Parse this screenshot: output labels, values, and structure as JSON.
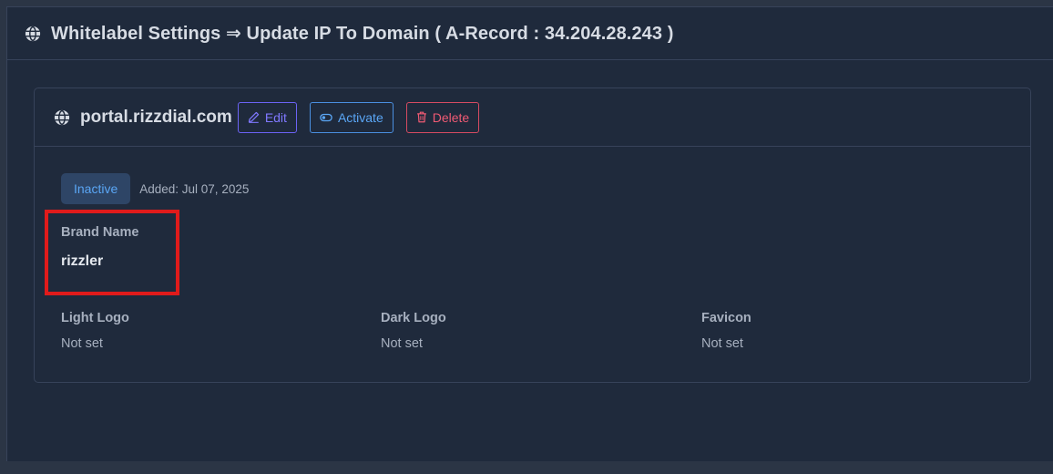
{
  "header": {
    "title": "Whitelabel Settings ⇒ Update IP To Domain ( A-Record : 34.204.28.243 )"
  },
  "card": {
    "domain": "portal.rizzdial.com",
    "buttons": {
      "edit": "Edit",
      "activate": "Activate",
      "delete": "Delete"
    },
    "status": "Inactive",
    "added": "Added: Jul 07, 2025",
    "brand_label": "Brand Name",
    "brand_value": "rizzler",
    "fields": [
      {
        "label": "Light Logo",
        "value": "Not set"
      },
      {
        "label": "Dark Logo",
        "value": "Not set"
      },
      {
        "label": "Favicon",
        "value": "Not set"
      }
    ]
  },
  "colors": {
    "background": "#1f2a3c",
    "edit": "#7f78ff",
    "activate": "#5aa6f5",
    "delete": "#ef5a73",
    "highlight": "#e01b1b"
  },
  "icons": {
    "header": "globe-icon",
    "domain": "globe-icon",
    "edit": "pencil-icon",
    "activate": "toggle-icon",
    "delete": "trash-icon"
  }
}
